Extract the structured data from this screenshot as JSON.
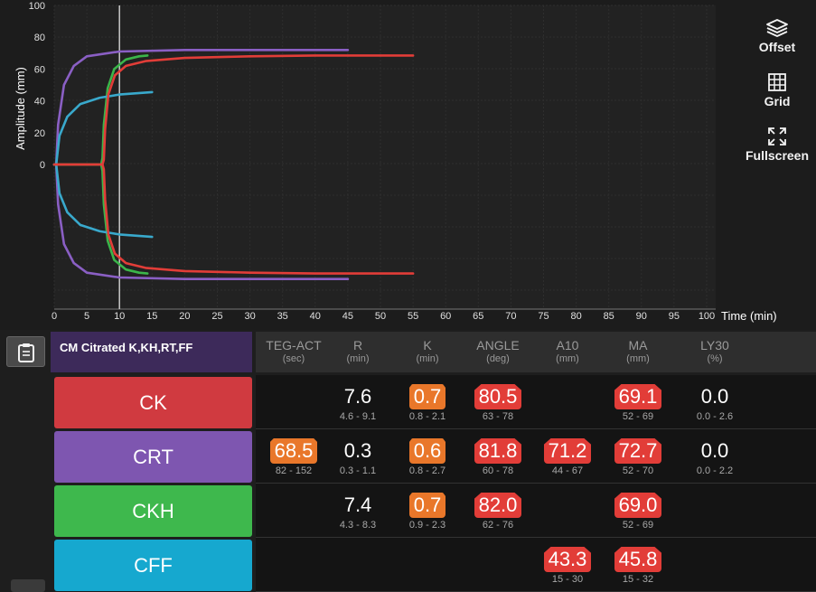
{
  "chart_data": {
    "type": "line",
    "xlabel": "Time (min)",
    "ylabel": "Amplitude (mm)",
    "xlim": [
      0,
      100
    ],
    "ylim": [
      -70,
      100
    ],
    "x_ticks": [
      "0",
      "5",
      "10",
      "15",
      "20",
      "25",
      "30",
      "35",
      "40",
      "45",
      "50",
      "55",
      "60",
      "65",
      "70",
      "75",
      "80",
      "85",
      "90",
      "95",
      "100"
    ],
    "y_ticks": [
      "100",
      "80",
      "60",
      "40",
      "20",
      "0"
    ],
    "grid": true,
    "marker_time": 10,
    "series": [
      {
        "color": "#8a5fc4",
        "r": 0.3,
        "upper": [
          [
            0,
            0
          ],
          [
            0.3,
            0
          ],
          [
            0.6,
            25
          ],
          [
            1.5,
            50
          ],
          [
            3,
            62
          ],
          [
            5,
            68
          ],
          [
            10,
            71
          ],
          [
            20,
            72
          ],
          [
            45,
            72
          ]
        ],
        "lower": [
          [
            0,
            0
          ],
          [
            0.3,
            0
          ],
          [
            0.6,
            -25
          ],
          [
            1.5,
            -50
          ],
          [
            3,
            -62
          ],
          [
            5,
            -68
          ],
          [
            10,
            -71
          ],
          [
            20,
            -72
          ],
          [
            45,
            -72
          ]
        ]
      },
      {
        "color": "#3bb54a",
        "r": 7.4,
        "upper": [
          [
            0,
            0
          ],
          [
            7.2,
            0
          ],
          [
            7.4,
            4
          ],
          [
            7.6,
            25
          ],
          [
            8.2,
            48
          ],
          [
            9.2,
            60
          ],
          [
            11,
            66
          ],
          [
            13,
            68
          ],
          [
            14.3,
            68.5
          ]
        ],
        "lower": [
          [
            0,
            0
          ],
          [
            7.2,
            0
          ],
          [
            7.4,
            -4
          ],
          [
            7.6,
            -25
          ],
          [
            8.2,
            -48
          ],
          [
            9.2,
            -60
          ],
          [
            11,
            -66
          ],
          [
            13,
            -68
          ],
          [
            14.3,
            -68.5
          ]
        ]
      },
      {
        "color": "#39a9cc",
        "r": 0.3,
        "upper": [
          [
            0,
            0
          ],
          [
            0.3,
            0
          ],
          [
            0.8,
            18
          ],
          [
            2,
            30
          ],
          [
            4,
            38
          ],
          [
            7,
            42
          ],
          [
            10,
            44
          ],
          [
            15,
            45.5
          ]
        ],
        "lower": [
          [
            0,
            0
          ],
          [
            0.3,
            0
          ],
          [
            0.8,
            -18
          ],
          [
            2,
            -30
          ],
          [
            4,
            -38
          ],
          [
            7,
            -42
          ],
          [
            10,
            -44
          ],
          [
            15,
            -45.5
          ]
        ]
      },
      {
        "color": "#e23d38",
        "r": 7.6,
        "upper": [
          [
            0,
            0
          ],
          [
            7.4,
            0
          ],
          [
            7.6,
            3
          ],
          [
            7.8,
            22
          ],
          [
            8.3,
            44
          ],
          [
            9.3,
            56
          ],
          [
            11,
            62
          ],
          [
            14,
            65
          ],
          [
            20,
            67
          ],
          [
            30,
            68
          ],
          [
            40,
            68.5
          ],
          [
            55,
            68.5
          ]
        ],
        "lower": [
          [
            0,
            0
          ],
          [
            7.4,
            0
          ],
          [
            7.6,
            -3
          ],
          [
            7.8,
            -22
          ],
          [
            8.3,
            -44
          ],
          [
            9.3,
            -56
          ],
          [
            11,
            -62
          ],
          [
            14,
            -65
          ],
          [
            20,
            -67
          ],
          [
            30,
            -68
          ],
          [
            40,
            -68.5
          ],
          [
            55,
            -68.5
          ]
        ]
      }
    ]
  },
  "toolbar": {
    "offset_label": "Offset",
    "grid_label": "Grid",
    "fullscreen_label": "Fullscreen"
  },
  "results": {
    "profile_name": "CM Citrated K,KH,RT,FF",
    "columns": [
      {
        "name": "TEG-ACT",
        "unit": "(sec)"
      },
      {
        "name": "R",
        "unit": "(min)"
      },
      {
        "name": "K",
        "unit": "(min)"
      },
      {
        "name": "ANGLE",
        "unit": "(deg)"
      },
      {
        "name": "A10",
        "unit": "(mm)"
      },
      {
        "name": "MA",
        "unit": "(mm)"
      },
      {
        "name": "LY30",
        "unit": "(%)"
      }
    ],
    "rows": [
      {
        "assay": "CK",
        "color": "#d03a40",
        "cells": [
          null,
          {
            "value": "7.6",
            "range": "4.6 - 9.1",
            "flag": ""
          },
          {
            "value": "0.7",
            "range": "0.8 - 2.1",
            "flag": "lo"
          },
          {
            "value": "80.5",
            "range": "63 - 78",
            "flag": "hi"
          },
          null,
          {
            "value": "69.1",
            "range": "52 - 69",
            "flag": "hi"
          },
          {
            "value": "0.0",
            "range": "0.0 - 2.6",
            "flag": ""
          }
        ]
      },
      {
        "assay": "CRT",
        "color": "#7e56b0",
        "cells": [
          {
            "value": "68.5",
            "range": "82 - 152",
            "flag": "lo"
          },
          {
            "value": "0.3",
            "range": "0.3 - 1.1",
            "flag": ""
          },
          {
            "value": "0.6",
            "range": "0.8 - 2.7",
            "flag": "lo"
          },
          {
            "value": "81.8",
            "range": "60 - 78",
            "flag": "hi"
          },
          {
            "value": "71.2",
            "range": "44 - 67",
            "flag": "hi"
          },
          {
            "value": "72.7",
            "range": "52 - 70",
            "flag": "hi"
          },
          {
            "value": "0.0",
            "range": "0.0 - 2.2",
            "flag": ""
          }
        ]
      },
      {
        "assay": "CKH",
        "color": "#3eb84d",
        "cells": [
          null,
          {
            "value": "7.4",
            "range": "4.3 - 8.3",
            "flag": ""
          },
          {
            "value": "0.7",
            "range": "0.9 - 2.3",
            "flag": "lo"
          },
          {
            "value": "82.0",
            "range": "62 - 76",
            "flag": "hi"
          },
          null,
          {
            "value": "69.0",
            "range": "52 - 69",
            "flag": "hi"
          },
          null
        ]
      },
      {
        "assay": "CFF",
        "color": "#16a8cf",
        "cells": [
          null,
          null,
          null,
          null,
          {
            "value": "43.3",
            "range": "15 - 30",
            "flag": "hi"
          },
          {
            "value": "45.8",
            "range": "15 - 32",
            "flag": "hi"
          },
          null
        ]
      }
    ]
  }
}
